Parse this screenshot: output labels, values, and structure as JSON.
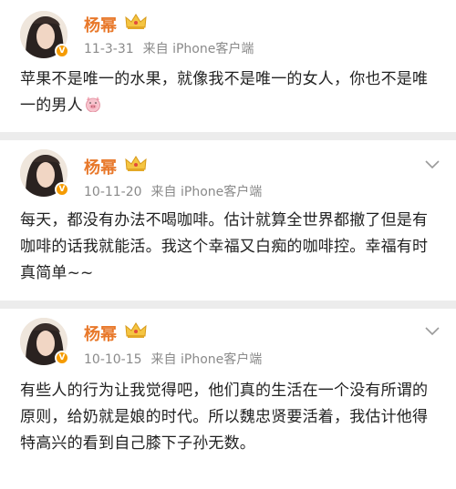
{
  "posts": [
    {
      "author": "杨幂",
      "date": "11-3-31",
      "source": "来自 iPhone客户端",
      "text": "苹果不是唯一的水果，就像我不是唯一的女人，你也不是唯一的男人",
      "emoji": "pig-face-icon"
    },
    {
      "author": "杨幂",
      "date": "10-11-20",
      "source": "来自 iPhone客户端",
      "text": "每天，都没有办法不喝咖啡。估计就算全世界都撤了但是有咖啡的话我就能活。我这个幸福又白痴的咖啡控。幸福有时真简单~~"
    },
    {
      "author": "杨幂",
      "date": "10-10-15",
      "source": "来自 iPhone客户端",
      "text": "有些人的行为让我觉得吧，他们真的生活在一个没有所谓的原则，给奶就是娘的时代。所以魏忠贤要活着，我估计他得特高兴的看到自己膝下子孙无数。"
    }
  ],
  "colors": {
    "name": "#e8782a",
    "meta": "#8a8a8a",
    "text": "#222222",
    "verified_badge": "#f59b00",
    "background": "#ececec"
  }
}
